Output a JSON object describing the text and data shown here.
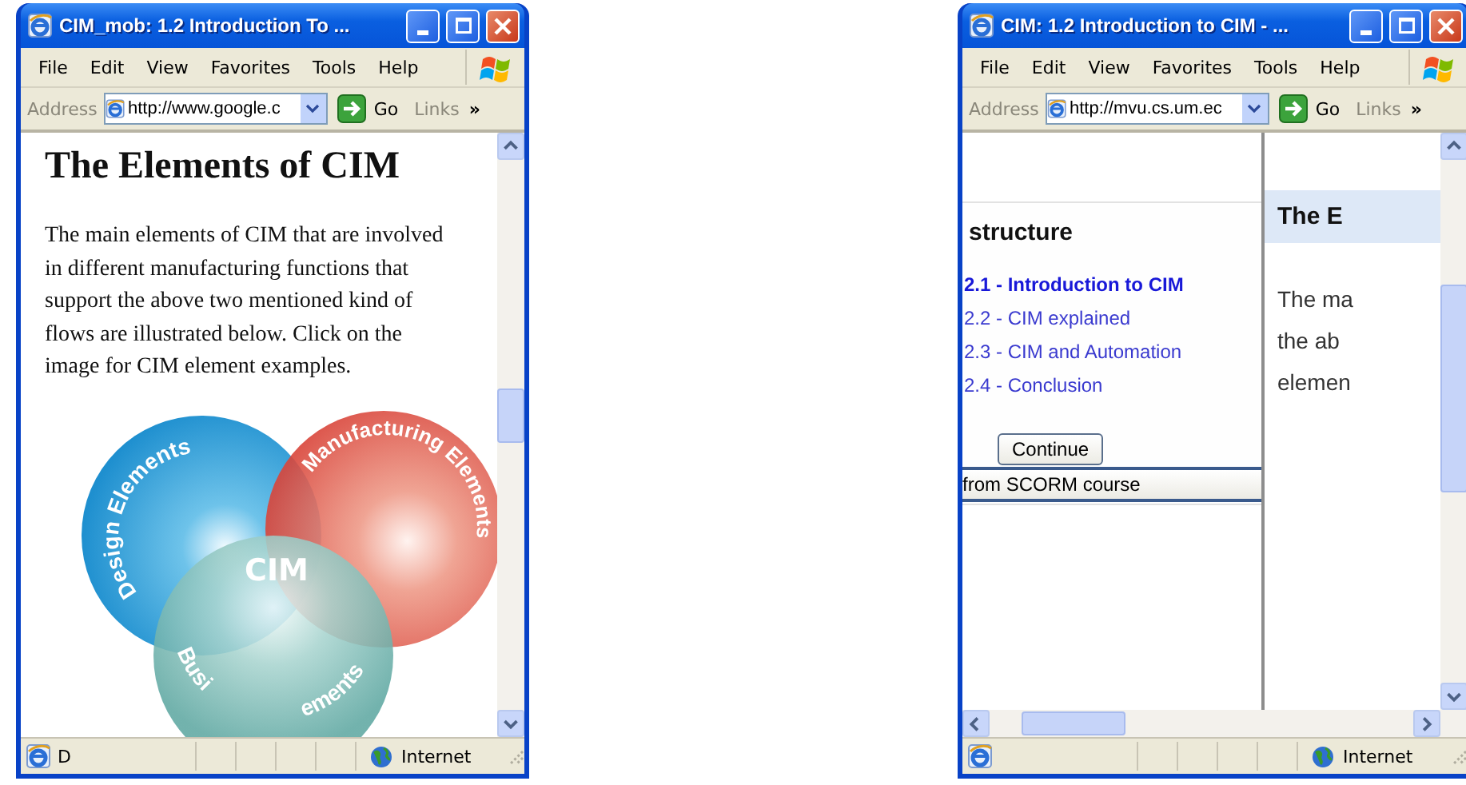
{
  "windows": [
    {
      "kind": "article",
      "title": "CIM_mob: 1.2 Introduction To ...",
      "menu": [
        "File",
        "Edit",
        "View",
        "Favorites",
        "Tools",
        "Help"
      ],
      "address_label": "Address",
      "url": "http://www.google.c",
      "go": "Go",
      "links": "Links",
      "chevron": "»",
      "content": {
        "heading": "The Elements of CIM",
        "paragraph": "The main elements of CIM that are involved in different manufacturing functions that support the above two mentioned kind of flows are illustrated below. Click on the image for CIM element examples.",
        "diagram": {
          "center": "CIM",
          "left": "Design Elements",
          "right": "Manufacturing Elements",
          "bottom_start": "Busi",
          "bottom_end": "ements"
        }
      },
      "status": {
        "text": "D",
        "zone": "Internet"
      }
    },
    {
      "kind": "frames",
      "title": "CIM: 1.2 Introduction to CIM - ...",
      "menu": [
        "File",
        "Edit",
        "View",
        "Favorites",
        "Tools",
        "Help"
      ],
      "address_label": "Address",
      "url": "http://mvu.cs.um.ec",
      "go": "Go",
      "links": "Links",
      "chevron": "»",
      "content": {
        "nav": {
          "heading": "structure",
          "links": [
            {
              "label": "2.1 - Introduction to CIM",
              "selected": true
            },
            {
              "label": "2.2 - CIM explained",
              "selected": false
            },
            {
              "label": "2.3 - CIM and Automation",
              "selected": false
            },
            {
              "label": "2.4 - Conclusion",
              "selected": false
            }
          ],
          "continue_button": "Continue",
          "exit_button": "from SCORM course"
        },
        "main": {
          "heading": "The E",
          "lines": [
            "The ma",
            "the ab",
            "elemen"
          ]
        }
      },
      "status": {
        "zone": "Internet"
      }
    }
  ]
}
